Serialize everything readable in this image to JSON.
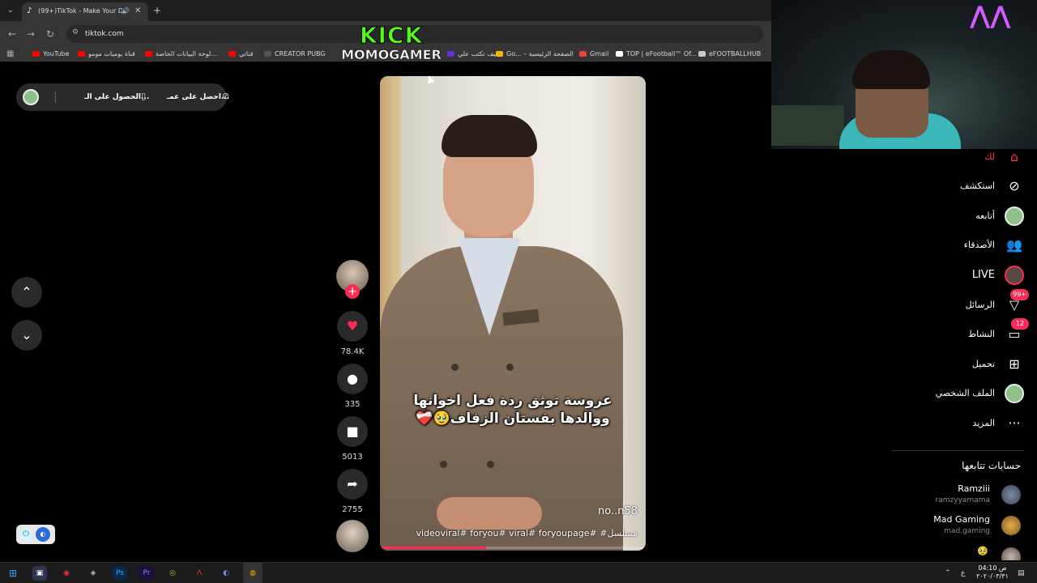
{
  "browser": {
    "tab_title": "(99+)TikTok - Make Your Da",
    "new_tab": "+",
    "url": "tiktok.com",
    "bookmarks": [
      {
        "label": "YouTube",
        "color": "#ff0000"
      },
      {
        "label": "قناة يوميات مومو",
        "color": "#ff0000"
      },
      {
        "label": "لوحة البيانات الخاصة...",
        "color": "#ff0000"
      },
      {
        "label": "قناتي",
        "color": "#ff0000"
      },
      {
        "label": "CREATOR PUBG",
        "color": "#2b2b2b"
      },
      {
        "label": "كيف تكتب علي",
        "color": "#6b2bd6"
      },
      {
        "label": "Go... – الصفحة الرئيسية",
        "color": "#f4b400"
      },
      {
        "label": "Gmail",
        "color": "#ea4335"
      },
      {
        "label": "TOP | eFootball™ Of...",
        "color": "#ffffff"
      },
      {
        "label": "eFOOTBALLHUB",
        "color": "#1a1a1a"
      }
    ]
  },
  "overlay": {
    "kick_line1": "KICK",
    "kick_line2": "MOMOGAMER"
  },
  "pill": {
    "item1": "احصل على عمـ...",
    "item2": "الحصول على الـ..."
  },
  "video": {
    "caption_line1": "عروسة توثق ردة فعل اخوانها",
    "caption_line2": "ووالدها بفستان الزفاف🥹❤️‍🩹",
    "watermark": "no..n58",
    "hashtags": "videoviral# foryou# viral# foryoupage# #مسلسل",
    "progress": 0.4
  },
  "actions": {
    "likes": "78.4K",
    "comments": "335",
    "saves": "5013",
    "shares": "2755"
  },
  "sidebar": {
    "for_you": "لك",
    "explore": "استكشف",
    "following": "أتابعه",
    "friends": "الأصدقاء",
    "live": "LIVE",
    "messages": "الرسائل",
    "messages_badge": "99+",
    "activity": "النشاط",
    "activity_badge": "12",
    "upload": "تحميل",
    "profile": "الملف الشخصي",
    "more": "المزيد",
    "following_accounts_title": "حسابات تتابعها",
    "accounts": [
      {
        "name": "Ramziii",
        "handle": "ramzyyamama"
      },
      {
        "name": "Mad Gaming",
        "handle": "mad.gaming"
      }
    ]
  },
  "taskbar": {
    "time": "04:10 ص",
    "date": "٢٠٢٠/٠٣/٣١",
    "lang": "ع"
  }
}
